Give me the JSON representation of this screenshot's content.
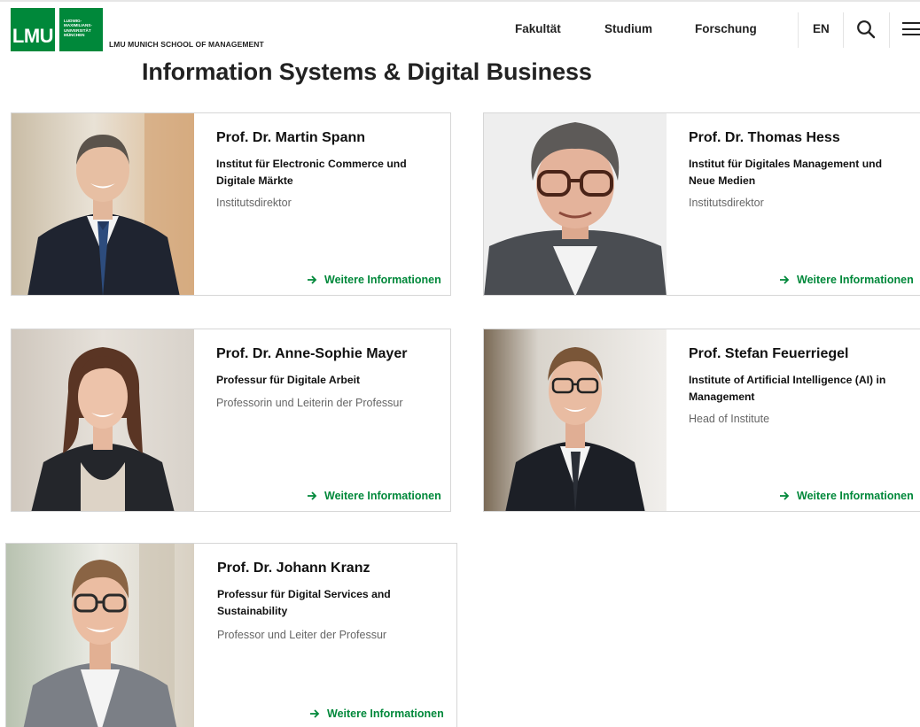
{
  "header": {
    "logo_text": "LMU",
    "logo_uni_lines": [
      "Ludwig-",
      "Maximilians-",
      "Universität",
      "München"
    ],
    "school_name": "LMU MUNICH SCHOOL OF MANAGEMENT",
    "nav": [
      "Fakultät",
      "Studium",
      "Forschung"
    ],
    "language": "EN",
    "icons": {
      "search": "search-icon",
      "menu": "hamburger-menu-icon"
    }
  },
  "page_title": "Information Systems & Digital Business",
  "colors": {
    "accent": "#00883a",
    "text": "#111111",
    "muted": "#666666",
    "border": "#d6d6d6"
  },
  "cards": [
    {
      "name": "Prof. Dr. Martin Spann",
      "institute": "Institut für Electronic Commerce und Digitale Märkte",
      "role": "Institutsdirektor",
      "link": "Weitere Informationen"
    },
    {
      "name": "Prof. Dr. Thomas Hess",
      "institute": "Institut für Digitales Management und Neue Medien",
      "role": "Institutsdirektor",
      "link": "Weitere Informationen"
    },
    {
      "name": "Prof. Dr. Anne-Sophie Mayer",
      "institute": "Professur für Digitale Arbeit",
      "role": "Professorin und Leiterin der Professur",
      "link": "Weitere Informationen"
    },
    {
      "name": "Prof. Stefan Feuerriegel",
      "institute": "Institute of Artificial Intelligence (AI) in Management",
      "role": "Head of Institute",
      "link": "Weitere Informationen"
    },
    {
      "name": "Prof. Dr. Johann Kranz",
      "institute": "Professur für Digital Services and Sustainability",
      "role": "Professor und Leiter der Professur",
      "link": "Weitere Informationen"
    }
  ]
}
